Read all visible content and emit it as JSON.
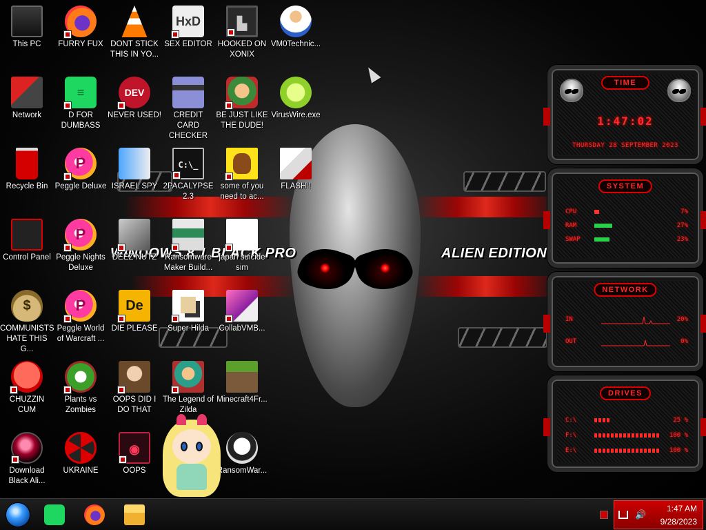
{
  "wallpaper": {
    "left_text": "WINDOWS 8.1 BLACK PRO",
    "right_text": "ALIEN EDITION 20"
  },
  "icons": [
    {
      "label": "This PC",
      "icon": "computer-icon"
    },
    {
      "label": "FURRY FUX",
      "icon": "firefox-icon"
    },
    {
      "label": "DONT STICK THIS IN YO...",
      "icon": "vlc-cone-icon"
    },
    {
      "label": "SEX EDITOR",
      "icon": "hex-editor-icon"
    },
    {
      "label": "HOOKED ON XONIX",
      "icon": "xonix-game-icon"
    },
    {
      "label": "VM0Technic...",
      "icon": "technician-icon"
    },
    {
      "label": "Network",
      "icon": "network-icon"
    },
    {
      "label": "D FOR DUMBASS",
      "icon": "spotify-icon"
    },
    {
      "label": "NEVER USED!",
      "icon": "dev-cpp-icon"
    },
    {
      "label": "CREDIT CARD CHECKER",
      "icon": "credit-card-icon"
    },
    {
      "label": "BE JUST LIKE THE DUDE!",
      "icon": "elf-icon"
    },
    {
      "label": "VirusWire.exe",
      "icon": "lime-icon"
    },
    {
      "label": "Recycle Bin",
      "icon": "recycle-bin-icon"
    },
    {
      "label": "Peggle Deluxe",
      "icon": "peggle-icon"
    },
    {
      "label": "ISRAEL SPY",
      "icon": "spy-app-icon"
    },
    {
      "label": "2PACALYPSE 2.3",
      "icon": "command-prompt-icon"
    },
    {
      "label": "some of you need to ac...",
      "icon": "dog-icon"
    },
    {
      "label": "FLASH !",
      "icon": "flash-icon"
    },
    {
      "label": "Control Panel",
      "icon": "control-panel-icon"
    },
    {
      "label": "Peggle Nights Deluxe",
      "icon": "peggle-nights-icon"
    },
    {
      "label": "DEEZ NUTZ",
      "icon": "window-stack-icon"
    },
    {
      "label": "Ransomware Maker Build...",
      "icon": "app-window-icon"
    },
    {
      "label": "japan suicide sim",
      "icon": "document-icon"
    },
    {
      "label": "COMMUNISTS HATE THIS G...",
      "icon": "money-bag-icon"
    },
    {
      "label": "Peggle World of Warcraft ...",
      "icon": "peggle-wow-icon"
    },
    {
      "label": "DIE PLEASE",
      "icon": "de-icon"
    },
    {
      "label": "Super Hilda",
      "icon": "pixel-game-icon"
    },
    {
      "label": "CollabVMB...",
      "icon": "software-box-icon"
    },
    {
      "label": "CHUZZIN CUM",
      "icon": "chuzzle-icon"
    },
    {
      "label": "Plants vs Zombies",
      "icon": "pvz-flower-icon"
    },
    {
      "label": "OOPS DID I DO THAT",
      "icon": "portrait-icon"
    },
    {
      "label": "The Legend of Zilda",
      "icon": "zelda-icon"
    },
    {
      "label": "Minecraft4Fr...",
      "icon": "minecraft-block-icon"
    },
    {
      "label": "Download Black Ali...",
      "icon": "alien-orb-icon"
    },
    {
      "label": "UKRAINE",
      "icon": "radiation-icon"
    },
    {
      "label": "OOPS",
      "icon": "oops-app-icon"
    },
    {
      "label": "RansomWar...",
      "icon": "skull-icon"
    }
  ],
  "gadget": {
    "time_panel": {
      "title": "TIME",
      "time": "1:47:02",
      "date": "THURSDAY 28 SEPTEMBER 2023"
    },
    "system_panel": {
      "title": "SYSTEM",
      "rows": [
        {
          "label": "CPU",
          "value": "7%",
          "level": 7
        },
        {
          "label": "RAM",
          "value": "27%",
          "level": 27
        },
        {
          "label": "SWAP",
          "value": "23%",
          "level": 23
        }
      ]
    },
    "network_panel": {
      "title": "NETWORK",
      "rows": [
        {
          "label": "IN",
          "value": "20%"
        },
        {
          "label": "OUT",
          "value": "0%"
        }
      ]
    },
    "drives_panel": {
      "title": "DRIVES",
      "rows": [
        {
          "label": "C:\\",
          "value": "25 %",
          "level": 25
        },
        {
          "label": "F:\\",
          "value": "100 %",
          "level": 100
        },
        {
          "label": "E:\\",
          "value": "100 %",
          "level": 100
        }
      ]
    }
  },
  "taskbar": {
    "pinned": [
      {
        "name": "spotify",
        "icon": "spotify-icon"
      },
      {
        "name": "firefox",
        "icon": "firefox-icon"
      },
      {
        "name": "file-explorer",
        "icon": "folder-icon"
      }
    ],
    "tray": {
      "time": "1:47 AM",
      "date": "9/28/2023"
    }
  },
  "colors": {
    "accent": "#ff2a2a",
    "tray": "#c00000",
    "ram_bar": "#2ad04a"
  }
}
